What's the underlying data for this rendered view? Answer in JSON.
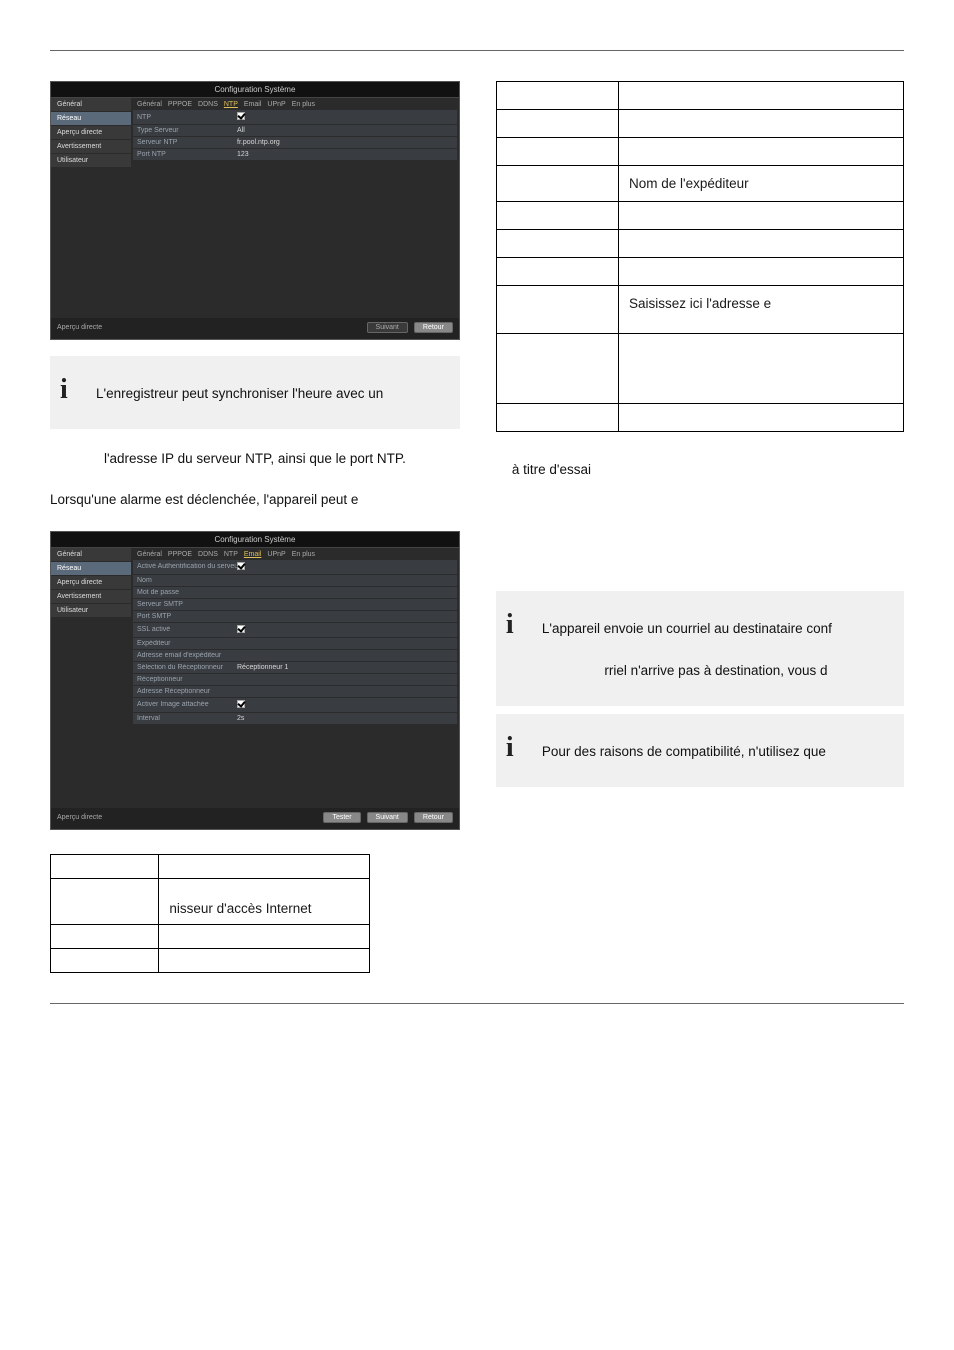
{
  "screenshot1": {
    "title": "Configuration Système",
    "sidebar": [
      "Général",
      "Réseau",
      "Aperçu directe",
      "Avertissement",
      "Utilisateur"
    ],
    "activeSidebar": 1,
    "tabs": [
      "Général",
      "PPPOE",
      "DDNS",
      "NTP",
      "Email",
      "UPnP",
      "En plus"
    ],
    "activeTab": 3,
    "rows": [
      {
        "label": "NTP",
        "type": "checkbox",
        "checked": true
      },
      {
        "label": "Type Serveur",
        "value": "All"
      },
      {
        "label": "Serveur NTP",
        "value": "fr.pool.ntp.org"
      },
      {
        "label": "Port NTP",
        "value": "123"
      }
    ],
    "footerLeft": "Aperçu directe",
    "buttons": [
      "Suivant",
      "Retour"
    ]
  },
  "info1": "L'enregistreur peut synchroniser l'heure avec un",
  "para1": "l'adresse IP du serveur NTP, ainsi que le port NTP.",
  "para2": "Lorsqu'une alarme est déclenchée, l'appareil peut e",
  "screenshot2": {
    "title": "Configuration Système",
    "sidebar": [
      "Général",
      "Réseau",
      "Aperçu directe",
      "Avertissement",
      "Utilisateur"
    ],
    "activeSidebar": 1,
    "tabs": [
      "Général",
      "PPPOE",
      "DDNS",
      "NTP",
      "Email",
      "UPnP",
      "En plus"
    ],
    "activeTab": 4,
    "rows": [
      {
        "label": "Activé Authentification du serveur",
        "type": "checkbox",
        "checked": true
      },
      {
        "label": "Nom",
        "value": ""
      },
      {
        "label": "Mot de passe",
        "value": ""
      },
      {
        "label": "Serveur SMTP",
        "value": ""
      },
      {
        "label": "Port SMTP",
        "value": ""
      },
      {
        "label": "SSL activé",
        "type": "checkbox",
        "checked": true
      },
      {
        "label": "Expéditeur",
        "value": ""
      },
      {
        "label": "Adresse email d'expéditeur",
        "value": ""
      },
      {
        "label": "Sélection du Réceptionneur",
        "value": "Réceptionneur 1"
      },
      {
        "label": "Réceptionneur",
        "value": ""
      },
      {
        "label": "Adresse Réceptionneur",
        "value": ""
      },
      {
        "label": "Activer Image attachée",
        "type": "checkbox",
        "checked": true
      },
      {
        "label": "Interval",
        "value": "2s"
      }
    ],
    "footerLeft": "Aperçu directe",
    "buttons": [
      "Tester",
      "Suivant",
      "Retour"
    ]
  },
  "rightTable": {
    "rows": [
      [
        "",
        ""
      ],
      [
        "",
        ""
      ],
      [
        "",
        ""
      ],
      [
        "",
        "Nom de l'expéditeur"
      ],
      [
        "",
        ""
      ],
      [
        "",
        ""
      ],
      [
        "",
        ""
      ],
      [
        "",
        "Saisissez ici l'adresse e"
      ],
      [
        "",
        ""
      ],
      [
        "",
        ""
      ]
    ]
  },
  "para3": "à titre d'essai",
  "info2": {
    "line1": "L'appareil envoie un courriel au destinataire conf",
    "line2": "rriel n'arrive pas à destination, vous d"
  },
  "info3": "Pour des raisons de compatibilité, n'utilisez que",
  "bottomTable": {
    "rows": [
      [
        "",
        ""
      ],
      [
        "",
        "nisseur d'accès Internet"
      ],
      [
        "",
        ""
      ],
      [
        "",
        ""
      ]
    ]
  }
}
